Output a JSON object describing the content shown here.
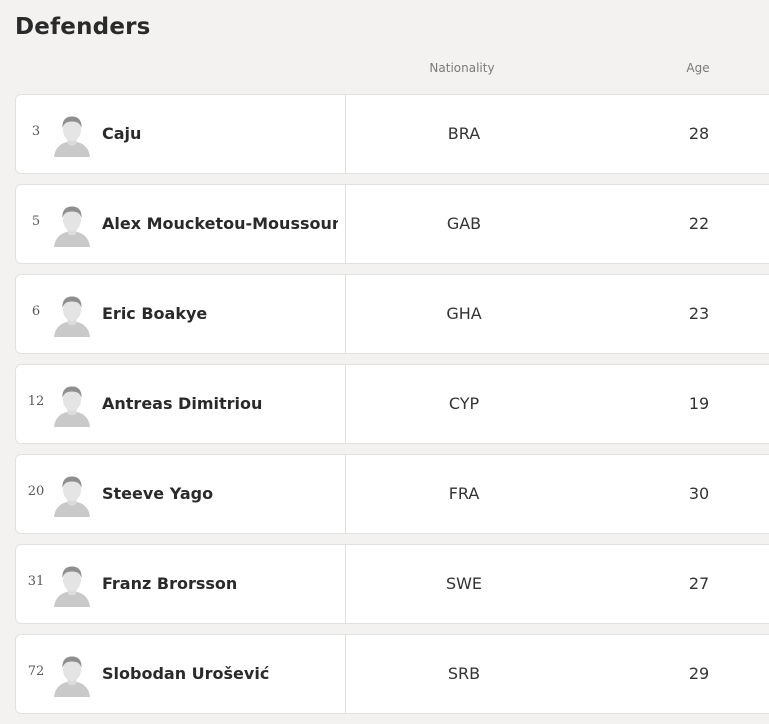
{
  "section": {
    "title": "Defenders"
  },
  "columns": {
    "nationality": "Nationality",
    "age": "Age"
  },
  "players": [
    {
      "number": "3",
      "name": "Caju",
      "nationality": "BRA",
      "age": "28",
      "avatar_icon": "player-silhouette-icon"
    },
    {
      "number": "5",
      "name": "Alex Moucketou-Moussounda",
      "nationality": "GAB",
      "age": "22",
      "avatar_icon": "player-silhouette-icon"
    },
    {
      "number": "6",
      "name": "Eric Boakye",
      "nationality": "GHA",
      "age": "23",
      "avatar_icon": "player-silhouette-icon"
    },
    {
      "number": "12",
      "name": "Antreas Dimitriou",
      "nationality": "CYP",
      "age": "19",
      "avatar_icon": "player-silhouette-icon"
    },
    {
      "number": "20",
      "name": "Steeve Yago",
      "nationality": "FRA",
      "age": "30",
      "avatar_icon": "player-silhouette-icon"
    },
    {
      "number": "31",
      "name": "Franz Brorsson",
      "nationality": "SWE",
      "age": "27",
      "avatar_icon": "player-silhouette-icon"
    },
    {
      "number": "72",
      "name": "Slobodan Urošević",
      "nationality": "SRB",
      "age": "29",
      "avatar_icon": "player-silhouette-icon"
    }
  ]
}
